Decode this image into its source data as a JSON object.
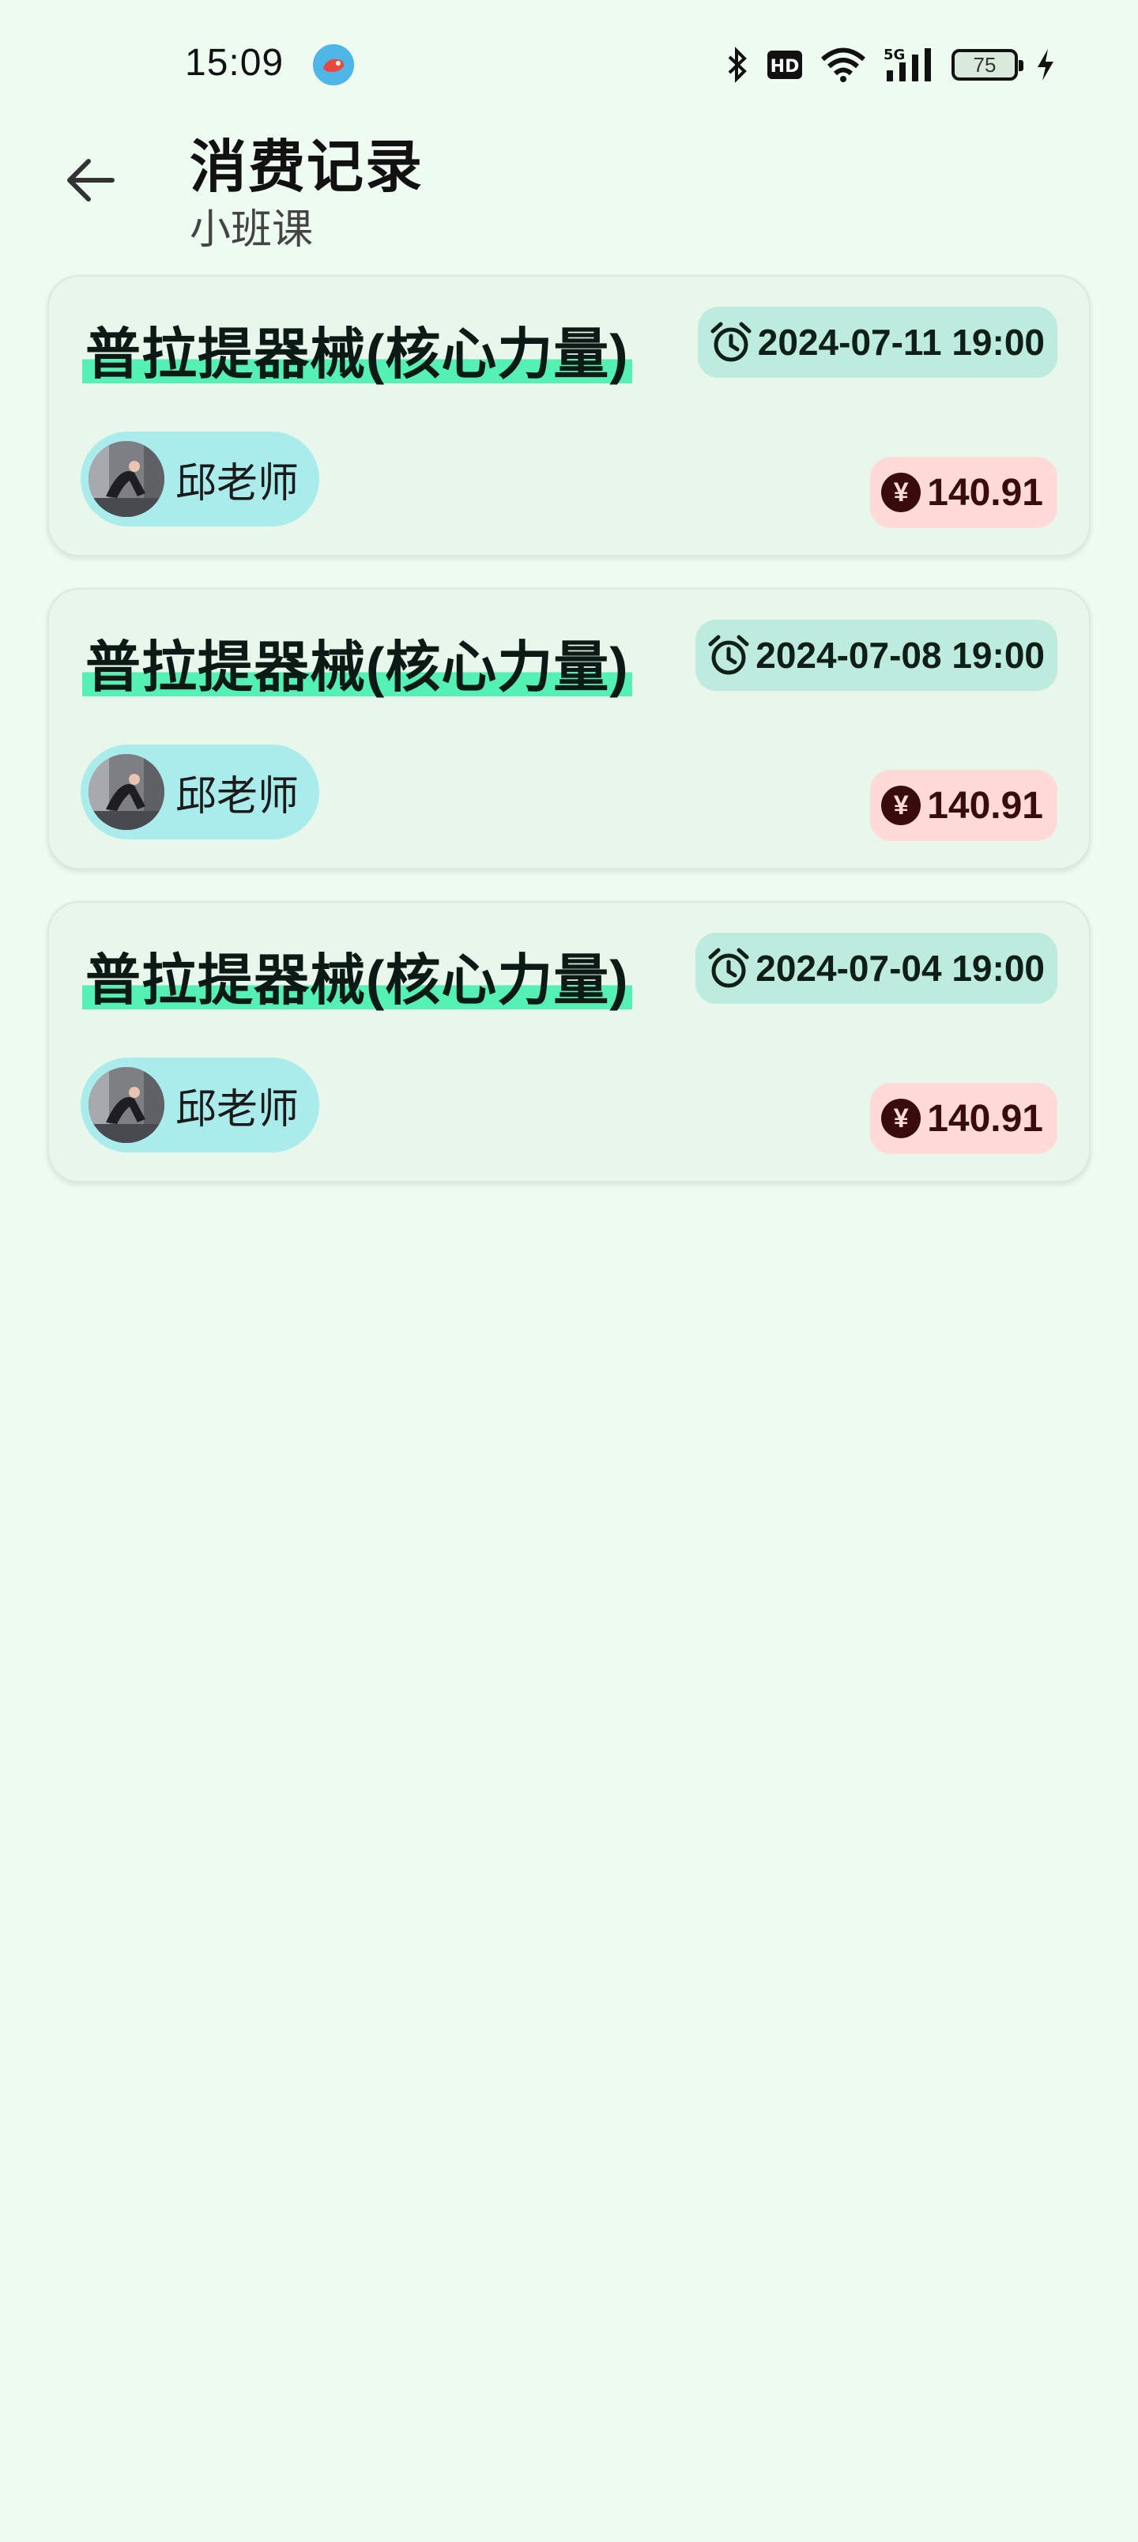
{
  "status_bar": {
    "time": "15:09",
    "battery": "75",
    "icons": [
      "app-notification-icon",
      "bluetooth-icon",
      "hd-icon",
      "wifi-icon",
      "5g-signal-icon",
      "battery-icon",
      "charging-icon"
    ]
  },
  "header": {
    "back_icon": "arrow-left-icon",
    "title": "消费记录",
    "subtitle": "小班课"
  },
  "records": [
    {
      "course": "普拉提器械(核心力量)",
      "time": "2024-07-11 19:00",
      "teacher": "邱老师",
      "price": "140.91"
    },
    {
      "course": "普拉提器械(核心力量)",
      "time": "2024-07-08 19:00",
      "teacher": "邱老师",
      "price": "140.91"
    },
    {
      "course": "普拉提器械(核心力量)",
      "time": "2024-07-04 19:00",
      "teacher": "邱老师",
      "price": "140.91"
    }
  ],
  "currency_symbol": "¥",
  "colors": {
    "background": "#effcf1",
    "card": "#e9f6ec",
    "highlight": "#55f0b4",
    "time_chip": "#bdebdd",
    "teacher_chip": "#aaeceb",
    "price_chip": "#ffdad6",
    "price_text": "#3a0b0b"
  }
}
